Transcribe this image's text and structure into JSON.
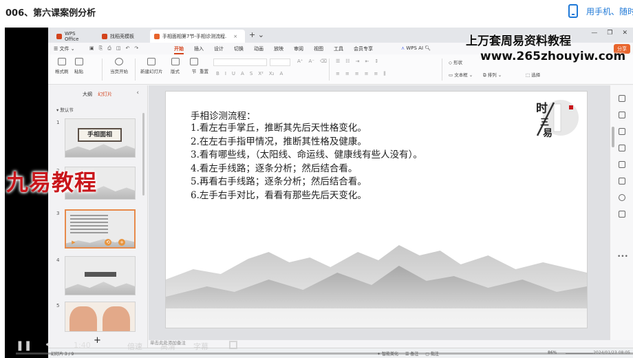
{
  "page": {
    "title": "006、第六课案例分析",
    "phone_link": "用手机、随时"
  },
  "wps": {
    "tabs": [
      {
        "label": "WPS Office",
        "color": "#d3431c"
      },
      {
        "label": "找稻壳模板",
        "color": "#d3431c"
      },
      {
        "label": "手相面相第7节-手相诊测流程.",
        "color": "#e8642c"
      }
    ],
    "menu": {
      "file": "文件",
      "items": [
        "开始",
        "插入",
        "设计",
        "切换",
        "动画",
        "放映",
        "审阅",
        "视图",
        "工具",
        "会员专享"
      ],
      "active": "开始",
      "wps_ai": "WPS AI",
      "share": "分享"
    },
    "ribbon": {
      "format_painter": "格式刷",
      "paste": "粘贴",
      "play_from_current": "当页开始",
      "new_slide": "新建幻灯片",
      "layout": "版式",
      "section": "节",
      "reset": "重置",
      "shapes": "形状",
      "textbox": "文本框",
      "arrange": "排列",
      "select": "选择"
    },
    "panel": {
      "tabs": [
        "大纲",
        "幻灯片"
      ],
      "active_tab": "幻灯片",
      "section": "默认节",
      "thumbs": [
        {
          "num": "1",
          "banner": "手相面相"
        },
        {
          "num": "2",
          "banner": ""
        },
        {
          "num": "3",
          "banner": ""
        },
        {
          "num": "4",
          "banner": ""
        },
        {
          "num": "5",
          "banner": ""
        }
      ],
      "add": "+"
    },
    "slide": {
      "heading": "手相诊测流程：",
      "items": [
        "1.看左右手掌丘，推断其先后天性格变化。",
        "2.在左右手指甲情况，推断其性格及健康。",
        "3.看有哪些线，（太阳线、命运线、健康线有些人没有）。",
        "4.看左手线路；逐条分析；然后结合看。",
        "5.再看右手线路；逐条分析；然后结合看。",
        "6.左手右手对比，看看有那些先后天变化。"
      ],
      "seal_chars": [
        "时",
        "三",
        "易"
      ]
    },
    "status": {
      "left": "幻灯片 3 / 9",
      "notes_hint": "单击此处添加备注",
      "smart": "智能美化",
      "notes": "备注",
      "comment": "批注",
      "zoom": "86%",
      "clock": "2024/01/23 08:05"
    }
  },
  "watermarks": {
    "top": "上万套周易资料教程",
    "url": "www.265zhouyiw.com",
    "left": "九易教程"
  },
  "video": {
    "time": "1:40",
    "speed": "倍速",
    "hd": "高清",
    "subtitle": "字幕"
  }
}
